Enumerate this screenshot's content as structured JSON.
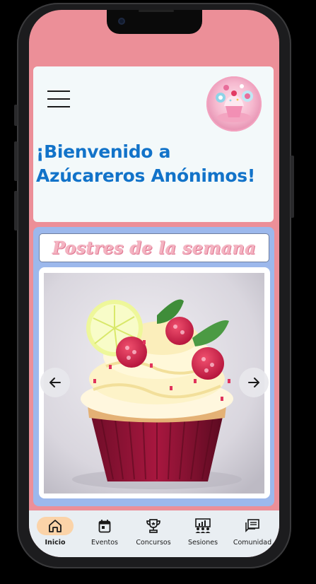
{
  "header": {
    "welcome_text": "¡Bienvenido a Azúcareros Anónimos!",
    "logo_icon": "cupcake-logo-icon",
    "menu_icon": "hamburger-menu-icon"
  },
  "featured": {
    "title": "Postres de la semana",
    "image_icon": "cupcake-photo",
    "prev_icon": "arrow-left-icon",
    "next_icon": "arrow-right-icon"
  },
  "bottom_nav": {
    "items": [
      {
        "label": "Inicio",
        "icon": "home-icon",
        "active": true
      },
      {
        "label": "Eventos",
        "icon": "calendar-icon",
        "active": false
      },
      {
        "label": "Concursos",
        "icon": "trophy-icon",
        "active": false
      },
      {
        "label": "Sesiones",
        "icon": "group-sessions-icon",
        "active": false
      },
      {
        "label": "Comunidad",
        "icon": "forum-icon",
        "active": false
      }
    ]
  },
  "colors": {
    "screen_bg": "#ec8f98",
    "welcome_text": "#1273c9",
    "content_bg": "#9cb8ec",
    "active_nav_pill": "#fbd3a8",
    "title_text": "#f4b3c1"
  }
}
